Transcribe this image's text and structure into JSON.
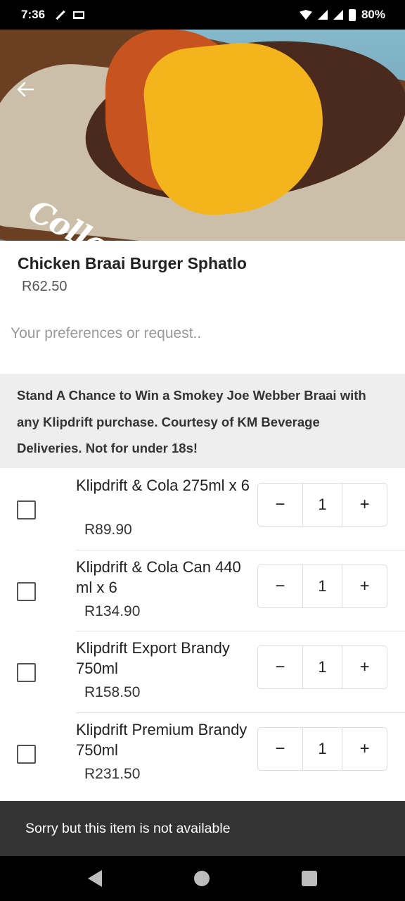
{
  "status_bar": {
    "time": "7:36",
    "battery": "80%"
  },
  "hero": {
    "watermark_text": "CollageK",
    "back_icon": "arrow-left-icon"
  },
  "product": {
    "title": "Chicken Braai Burger Sphatlo",
    "price": "R62.50"
  },
  "preferences": {
    "placeholder": "Your preferences or request.."
  },
  "promo": {
    "text": "Stand A Chance to Win a Smokey Joe Webber Braai with any Klipdrift purchase. Courtesy of KM Beverage Deliveries. Not for under 18s!"
  },
  "items": [
    {
      "name": "Klipdrift & Cola 275ml x 6",
      "price": "R89.90",
      "qty": "1",
      "minus": "−",
      "plus": "+"
    },
    {
      "name": "Klipdrift & Cola Can 440 ml x 6",
      "price": "R134.90",
      "qty": "1",
      "minus": "−",
      "plus": "+"
    },
    {
      "name": "Klipdrift Export Brandy 750ml",
      "price": "R158.50",
      "qty": "1",
      "minus": "−",
      "plus": "+"
    },
    {
      "name": "Klipdrift Premium Brandy 750ml",
      "price": "R231.50",
      "qty": "1",
      "minus": "−",
      "plus": "+"
    }
  ],
  "snackbar": {
    "message": "Sorry but this item is not available"
  }
}
